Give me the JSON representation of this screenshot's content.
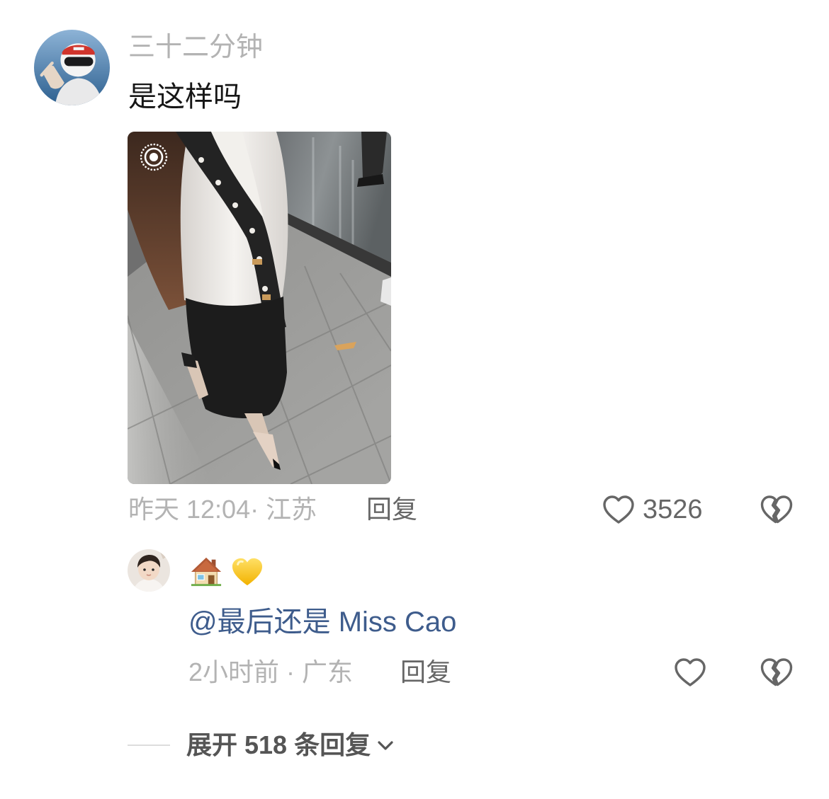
{
  "colors": {
    "username": "#b3b3b3",
    "body_text": "#161616",
    "meta_text": "#b3b3b3",
    "action_text": "#666666",
    "mention": "#3e5c8c",
    "expand_text": "#555555",
    "icon_stroke": "#666666",
    "divider": "#dddddd"
  },
  "comment": {
    "username": "三十二分钟",
    "text": "是这样吗",
    "image": {
      "badge_icon": "live-photo-icon"
    },
    "time_location": "昨天 12:04· 江苏",
    "reply_label": "回复",
    "like_icon": "heart-outline-icon",
    "like_count": "3526",
    "dislike_icon": "broken-heart-icon"
  },
  "reply": {
    "content_emoji": [
      "house-emoji",
      "yellow-heart-emoji"
    ],
    "mention": "@最后还是 Miss Cao",
    "time_location": "2小时前 · 广东",
    "reply_label": "回复",
    "like_icon": "heart-outline-icon",
    "dislike_icon": "broken-heart-icon"
  },
  "expand_replies": {
    "label": "展开 518 条回复",
    "icon": "chevron-down-icon"
  }
}
